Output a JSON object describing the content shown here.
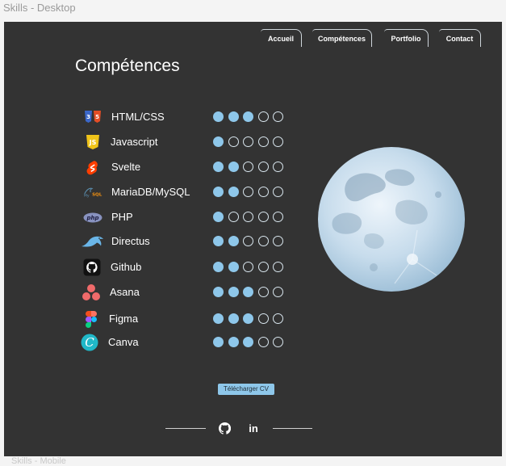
{
  "frame": {
    "title": "Skills - Desktop",
    "next_frame_title": "Skills - Mobile"
  },
  "nav": {
    "items": [
      "Accueil",
      "Compétences",
      "Portfolio",
      "Contact"
    ]
  },
  "page": {
    "title": "Compétences"
  },
  "skills": [
    {
      "name": "HTML/CSS",
      "icon": "html-css-icon",
      "level": 3,
      "max": 5
    },
    {
      "name": "Javascript",
      "icon": "javascript-icon",
      "level": 1,
      "max": 5
    },
    {
      "name": "Svelte",
      "icon": "svelte-icon",
      "level": 2,
      "max": 5
    },
    {
      "name": "MariaDB/MySQL",
      "icon": "mysql-icon",
      "level": 2,
      "max": 5
    },
    {
      "name": "PHP",
      "icon": "php-icon",
      "level": 1,
      "max": 5
    },
    {
      "name": "Directus",
      "icon": "directus-icon",
      "level": 2,
      "max": 5
    },
    {
      "name": "Github",
      "icon": "github-icon",
      "level": 2,
      "max": 5
    },
    {
      "name": "Asana",
      "icon": "asana-icon",
      "level": 3,
      "max": 5
    },
    {
      "name": "Figma",
      "icon": "figma-icon",
      "level": 3,
      "max": 5
    },
    {
      "name": "Canva",
      "icon": "canva-icon",
      "level": 3,
      "max": 5
    }
  ],
  "cv": {
    "label": "Télécharger CV"
  },
  "footer": {
    "github": "github-icon",
    "linkedin_label": "in"
  },
  "colors": {
    "background": "#333333",
    "accent": "#8ec7ea",
    "text": "#ffffff"
  }
}
